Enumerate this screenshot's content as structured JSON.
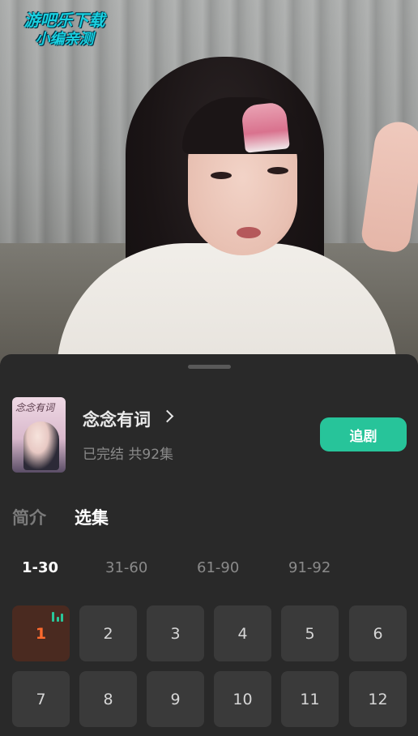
{
  "watermark": {
    "line1": "游吧乐下载",
    "line2": "小编亲测"
  },
  "show": {
    "poster_text": "念念有词",
    "title": "念念有词",
    "status": "已完结 共92集",
    "follow_label": "追剧"
  },
  "tabs": [
    {
      "label": "简介",
      "active": false
    },
    {
      "label": "选集",
      "active": true
    }
  ],
  "ranges": [
    {
      "label": "1-30",
      "active": true
    },
    {
      "label": "31-60",
      "active": false
    },
    {
      "label": "61-90",
      "active": false
    },
    {
      "label": "91-92",
      "active": false
    }
  ],
  "episodes": [
    "1",
    "2",
    "3",
    "4",
    "5",
    "6",
    "7",
    "8",
    "9",
    "10",
    "11",
    "12"
  ],
  "current_episode": "1",
  "colors": {
    "accent": "#27c49a",
    "current_episode_text": "#ff6a2e",
    "sheet_bg": "#292929"
  }
}
